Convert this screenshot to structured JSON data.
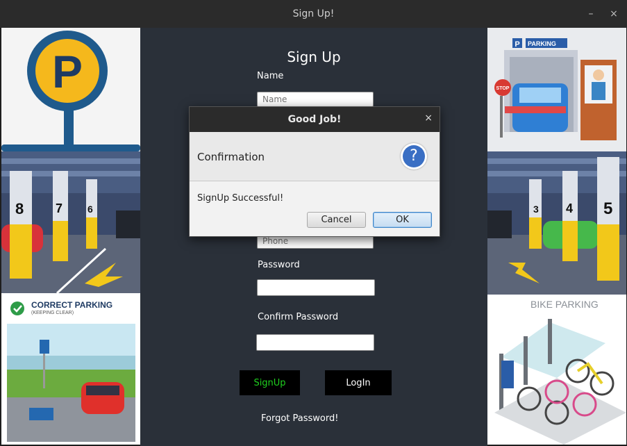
{
  "window": {
    "title": "Sign Up!",
    "minimize": "–",
    "close": "×"
  },
  "form": {
    "heading": "Sign Up",
    "name_label": "Name",
    "name_placeholder": "Name",
    "phone_placeholder": "Phone",
    "password_label": "Password",
    "confirm_label": "Confirm Password",
    "signup_button": "SignUp",
    "login_button": "LogIn",
    "forgot_link": "Forgot Password!"
  },
  "images": {
    "correct_parking_title": "CORRECT PARKING",
    "correct_parking_sub": "(KEEPING CLEAR)",
    "bike_parking": "BIKE PARKING",
    "parking_sign": "PARKING",
    "stop": "STOP",
    "pillar_left": [
      "8",
      "7",
      "6"
    ],
    "pillar_right": [
      "3",
      "4",
      "5"
    ]
  },
  "dialog": {
    "title": "Good Job!",
    "close": "×",
    "header": "Confirmation",
    "icon": "?",
    "message": "SignUp Successful!",
    "cancel": "Cancel",
    "ok": "OK"
  },
  "colors": {
    "signup_text": "#1fd11f",
    "panel_bg": "#2a3039",
    "dialog_default": "#cfe3f5"
  }
}
